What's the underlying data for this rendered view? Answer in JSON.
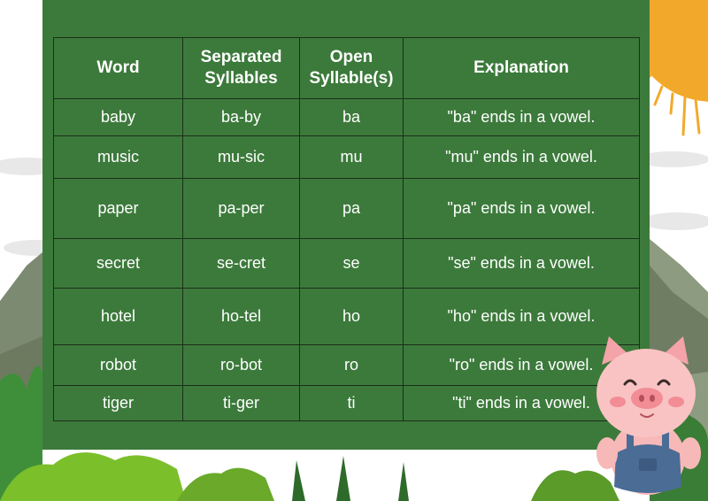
{
  "table": {
    "headers": {
      "word": "Word",
      "separated_line1": "Separated",
      "separated_line2": "Syllables",
      "open_line1": "Open",
      "open_line2": "Syllable(s)",
      "explanation": "Explanation"
    },
    "rows": [
      {
        "word": "baby",
        "separated": "ba-by",
        "open": "ba",
        "explanation": "\"ba\" ends in a vowel."
      },
      {
        "word": "music",
        "separated": "mu-sic",
        "open": "mu",
        "explanation": "\"mu\" ends in a vowel."
      },
      {
        "word": "paper",
        "separated": "pa-per",
        "open": "pa",
        "explanation": "\"pa\" ends in a vowel."
      },
      {
        "word": "secret",
        "separated": "se-cret",
        "open": "se",
        "explanation": "\"se\" ends in a vowel."
      },
      {
        "word": "hotel",
        "separated": "ho-tel",
        "open": "ho",
        "explanation": "\"ho\" ends in a vowel."
      },
      {
        "word": "robot",
        "separated": "ro-bot",
        "open": "ro",
        "explanation": "\"ro\" ends in a vowel."
      },
      {
        "word": "tiger",
        "separated": "ti-ger",
        "open": "ti",
        "explanation": "\"ti\" ends in a vowel."
      }
    ]
  },
  "colors": {
    "board": "#3c7a3b",
    "text": "#ffffff",
    "sun": "#f2a92b",
    "pig": "#f7b8b8",
    "overalls": "#4a6c95"
  },
  "decor": [
    "sun-icon",
    "mountain-icon",
    "cloud-icon",
    "bush-icon",
    "pig-icon"
  ]
}
